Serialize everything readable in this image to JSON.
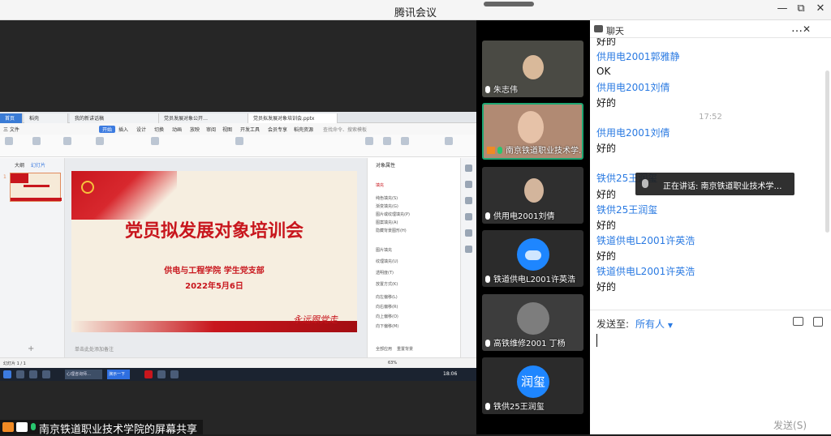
{
  "window": {
    "title": "腾讯会议",
    "minimize": "—",
    "restore": "⧉",
    "close": "✕"
  },
  "shared_screen": {
    "wps_tabs": [
      "首页",
      "稻壳",
      "我的新讲话稿",
      "党员发展对象公开…",
      "党员拟发展对象培训会.pptx"
    ],
    "menu": [
      "三 文件",
      "开始",
      "插入",
      "设计",
      "切换",
      "动画",
      "放映",
      "审阅",
      "视图",
      "开发工具",
      "会员专享",
      "稻壳资源"
    ],
    "search_hint": "查找命令、搜索模板",
    "slide": {
      "title": "党员拟发展对象培训会",
      "subtitle": "供电与工程学院  学生党支部",
      "date": "2022年5月6日",
      "signature": "永远跟党走"
    },
    "thumb_tabs": [
      "大纲",
      "幻灯片"
    ],
    "thumb_number": "1",
    "props_title": "对象属性",
    "props_fill": "填充",
    "props_options": [
      "纯色填充(S)",
      "渐变填充(G)",
      "图片或纹理填充(P)",
      "图案填充(A)",
      "隐藏背景图形(H)"
    ],
    "props_rows": [
      "图片填充",
      "纹理填充(U)",
      "透明度(T)",
      "放置方式(K)",
      "向左偏移(L)",
      "向右偏移(R)",
      "向上偏移(O)",
      "向下偏移(M)"
    ],
    "props_bottom": [
      "全部应用",
      "重置背景"
    ],
    "notes_hint": "单击此处添加备注",
    "status_left": "幻灯片 1 / 1",
    "status_zoom": "63%",
    "taskbar_items": [
      "心理咨询师…",
      "演示一下"
    ],
    "clock": "18:06"
  },
  "sharer_label": "南京铁道职业技术学院的屏幕共享",
  "videos": [
    {
      "name": "朱志伟"
    },
    {
      "name": "南京铁道职业技术学…"
    },
    {
      "name": "供用电2001刘倩"
    },
    {
      "name": "铁道供电L2001许英浩"
    },
    {
      "name": "高铁维修2001 丁杨"
    },
    {
      "name": "铁供25王润玺",
      "avatar": "润玺"
    }
  ],
  "chat": {
    "title": "聊天",
    "more": "…",
    "close": "✕",
    "messages": [
      {
        "type": "text",
        "text": "好的"
      },
      {
        "type": "name",
        "text": "供用电2001郭雅静"
      },
      {
        "type": "text",
        "text": "OK"
      },
      {
        "type": "name",
        "text": "供用电2001刘倩"
      },
      {
        "type": "text",
        "text": "好的"
      },
      {
        "type": "time",
        "text": "17:52"
      },
      {
        "type": "name",
        "text": "供用电2001刘倩"
      },
      {
        "type": "text",
        "text": "好的"
      },
      {
        "type": "name",
        "text": "铁供25王润玺"
      },
      {
        "type": "text",
        "text": "好的"
      },
      {
        "type": "name",
        "text": "铁供25王润玺"
      },
      {
        "type": "text",
        "text": "好的"
      },
      {
        "type": "name",
        "text": "铁道供电L2001许英浩"
      },
      {
        "type": "text",
        "text": "好的"
      },
      {
        "type": "name",
        "text": "铁道供电L2001许英浩"
      },
      {
        "type": "text",
        "text": "好的"
      }
    ],
    "speaking": "正在讲话: 南京铁道职业技术学…",
    "send_to_label": "发送至:",
    "send_to_value": "所有人",
    "send_button": "发送(S)"
  },
  "colors": {
    "accent": "#2a7ae2",
    "active_speaker": "#1ea672",
    "slide_red": "#c8161d"
  }
}
